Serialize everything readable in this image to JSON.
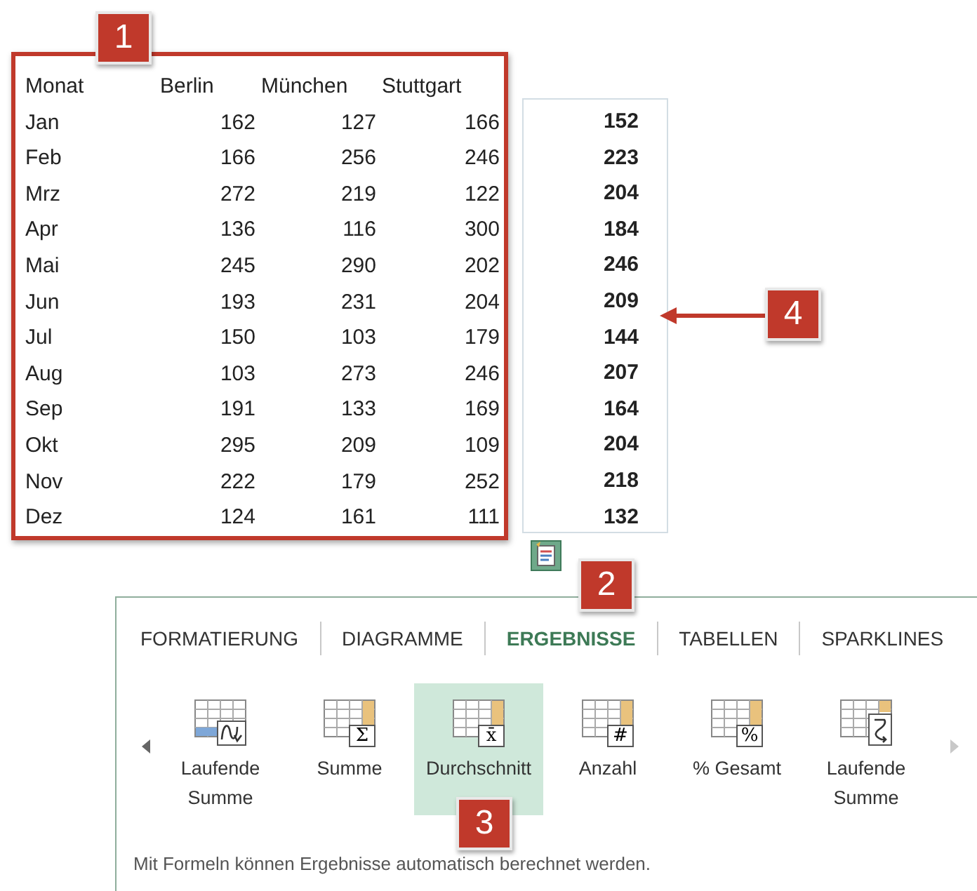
{
  "table": {
    "columns": [
      "Monat",
      "Berlin",
      "München",
      "Stuttgart"
    ],
    "rows": [
      [
        "Jan",
        "162",
        "127",
        "166"
      ],
      [
        "Feb",
        "166",
        "256",
        "246"
      ],
      [
        "Mrz",
        "272",
        "219",
        "122"
      ],
      [
        "Apr",
        "136",
        "116",
        "300"
      ],
      [
        "Mai",
        "245",
        "290",
        "202"
      ],
      [
        "Jun",
        "193",
        "231",
        "204"
      ],
      [
        "Jul",
        "150",
        "103",
        "179"
      ],
      [
        "Aug",
        "103",
        "273",
        "246"
      ],
      [
        "Sep",
        "191",
        "133",
        "169"
      ],
      [
        "Okt",
        "295",
        "209",
        "109"
      ],
      [
        "Nov",
        "222",
        "179",
        "252"
      ],
      [
        "Dez",
        "124",
        "161",
        "111"
      ]
    ]
  },
  "results": [
    "152",
    "223",
    "204",
    "184",
    "246",
    "209",
    "144",
    "207",
    "164",
    "204",
    "218",
    "132"
  ],
  "callouts": [
    {
      "label": "1"
    },
    {
      "label": "2"
    },
    {
      "label": "3"
    },
    {
      "label": "4"
    }
  ],
  "quick_analysis": {
    "tabs": [
      {
        "label": "FORMATIERUNG",
        "selected": false
      },
      {
        "label": "DIAGRAMME",
        "selected": false
      },
      {
        "label": "ERGEBNISSE",
        "selected": true
      },
      {
        "label": "TABELLEN",
        "selected": false
      },
      {
        "label": "SPARKLINES",
        "selected": false
      }
    ],
    "scroll_left": {
      "disabled": false
    },
    "scroll_right": {
      "disabled": true
    },
    "items": [
      {
        "label": "Laufende Summe",
        "kind": "rowtotal",
        "selected": false
      },
      {
        "label": "Summe",
        "kind": "symbol",
        "symbol": "Σ",
        "selected": false
      },
      {
        "label": "Durchschnitt",
        "kind": "symbol",
        "symbol": "x̄",
        "selected": true
      },
      {
        "label": "Anzahl",
        "kind": "symbol",
        "symbol": "#",
        "selected": false
      },
      {
        "label": "% Gesamt",
        "kind": "symbol",
        "symbol": "%",
        "selected": false
      },
      {
        "label": "Laufende Summe",
        "kind": "coltotal",
        "selected": false
      }
    ],
    "description": "Mit Formeln können Ergebnisse automatisch berechnet werden."
  }
}
